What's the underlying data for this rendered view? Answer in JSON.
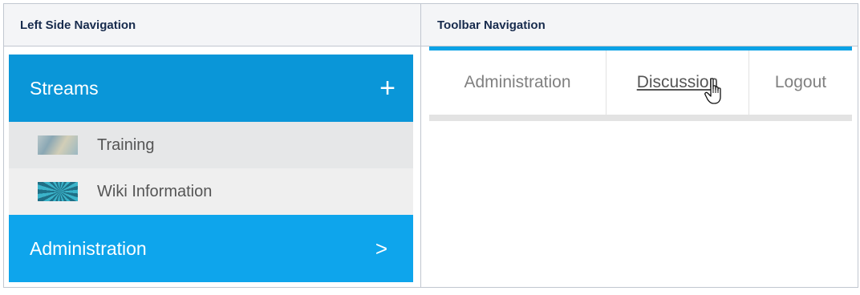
{
  "table": {
    "col1_header": "Left Side Navigation",
    "col2_header": "Toolbar Navigation"
  },
  "left_nav": {
    "streams_label": "Streams",
    "streams_action": "+",
    "items": [
      {
        "label": "Training",
        "icon": "training-thumbnail"
      },
      {
        "label": "Wiki Information",
        "icon": "wiki-thumbnail"
      }
    ],
    "admin_label": "Administration",
    "admin_action": ">"
  },
  "toolbar": {
    "items": [
      "Administration",
      "Discussion",
      "Logout"
    ],
    "hovered": "Discussion",
    "cursor_icon": "hand-pointer-icon"
  },
  "colors": {
    "stream_header": "#0a96d8",
    "admin_header": "#0ea5ec",
    "toolbar_accent": "#0aa2e6"
  }
}
